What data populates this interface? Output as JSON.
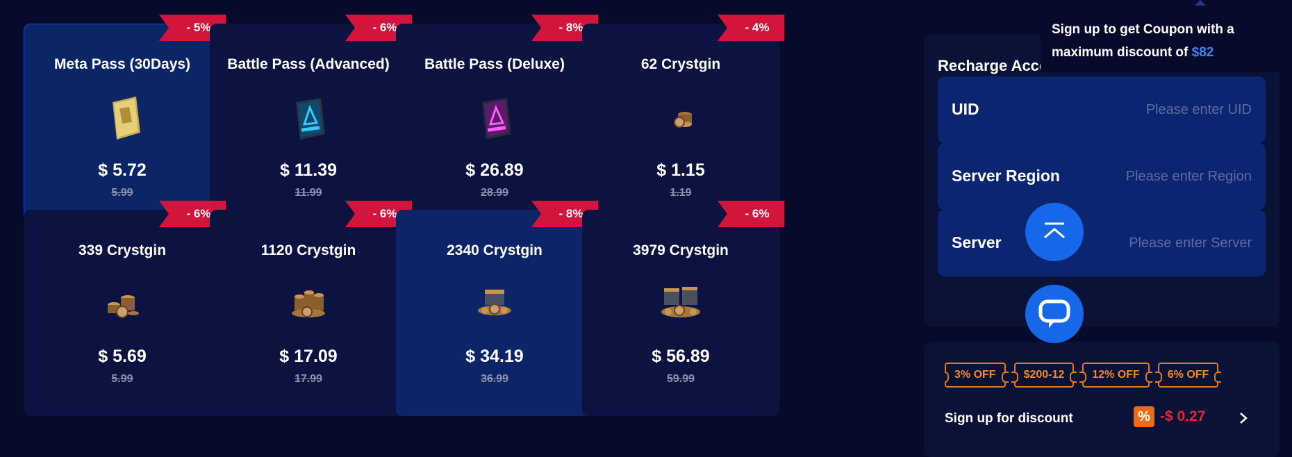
{
  "products": [
    {
      "title": "Meta Pass (30Days)",
      "price": "$ 5.72",
      "old_price": "5.99",
      "discount": "- 5%",
      "icon": "gold-pass-card-icon",
      "state": "selected"
    },
    {
      "title": "Battle Pass (Advanced)",
      "price": "$ 11.39",
      "old_price": "11.99",
      "discount": "- 6%",
      "icon": "advanced-pass-card-icon",
      "state": "normal"
    },
    {
      "title": "Battle Pass (Deluxe)",
      "price": "$ 26.89",
      "old_price": "28.99",
      "discount": "- 8%",
      "icon": "deluxe-pass-card-icon",
      "state": "normal"
    },
    {
      "title": "62 Crystgin",
      "price": "$ 1.15",
      "old_price": "1.19",
      "discount": "- 4%",
      "icon": "crystgin-coins-small-icon",
      "state": "normal"
    },
    {
      "title": "339 Crystgin",
      "price": "$ 5.69",
      "old_price": "5.99",
      "discount": "- 6%",
      "icon": "crystgin-coins-stack-icon",
      "state": "normal"
    },
    {
      "title": "1120 Crystgin",
      "price": "$ 17.09",
      "old_price": "17.99",
      "discount": "- 6%",
      "icon": "crystgin-coins-pile-icon",
      "state": "normal"
    },
    {
      "title": "2340 Crystgin",
      "price": "$ 34.19",
      "old_price": "36.99",
      "discount": "- 8%",
      "icon": "crystgin-chest-icon",
      "state": "hover"
    },
    {
      "title": "3979 Crystgin",
      "price": "$ 56.89",
      "old_price": "59.99",
      "discount": "- 6%",
      "icon": "crystgin-chests-icon",
      "state": "normal"
    }
  ],
  "tooltip": {
    "text_line1": "Sign up to get Coupon with a",
    "text_line2": "maximum discount of",
    "amount": "$82"
  },
  "recharge": {
    "title": "Recharge Account",
    "fields": [
      {
        "label": "UID",
        "placeholder": "Please enter UID"
      },
      {
        "label": "Server Region",
        "placeholder": "Please enter Region"
      },
      {
        "label": "Server",
        "placeholder": "Please enter Server"
      }
    ]
  },
  "coupons": [
    "3% OFF",
    "$200-12",
    "12% OFF",
    "6% OFF"
  ],
  "signup": {
    "label": "Sign up for discount",
    "badge": "%",
    "amount": "-$ 0.27"
  },
  "floating": {
    "scroll_top_icon": "scroll-to-top-icon",
    "chat_icon": "chat-bubble-icon"
  },
  "colors": {
    "background": "#070b2b",
    "card": "#0c1340",
    "card_selected": "#0c2566",
    "ribbon": "#d3143c",
    "accent_blue": "#1668e8",
    "coupon_orange": "#e07a1b",
    "discount_red": "#e5262f"
  }
}
